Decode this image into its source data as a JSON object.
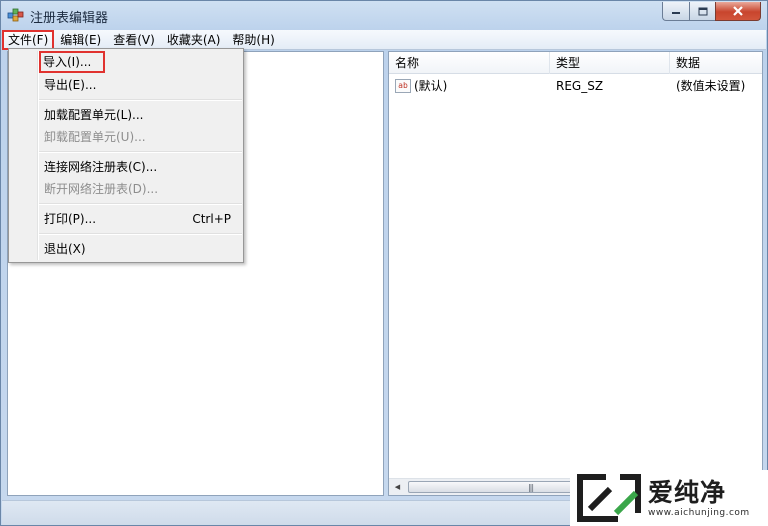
{
  "window": {
    "title": "注册表编辑器",
    "icon": "regedit-icon"
  },
  "menubar": {
    "items": [
      "文件(F)",
      "编辑(E)",
      "查看(V)",
      "收藏夹(A)",
      "帮助(H)"
    ]
  },
  "file_menu": {
    "items": [
      {
        "label": "导入(I)...",
        "disabled": false,
        "highlighted": true
      },
      {
        "label": "导出(E)...",
        "disabled": false
      },
      {
        "label": "加载配置单元(L)...",
        "disabled": false
      },
      {
        "label": "卸载配置单元(U)...",
        "disabled": true
      },
      {
        "label": "连接网络注册表(C)...",
        "disabled": false
      },
      {
        "label": "断开网络注册表(D)...",
        "disabled": true
      },
      {
        "label": "打印(P)...",
        "disabled": false,
        "shortcut": "Ctrl+P"
      },
      {
        "label": "退出(X)",
        "disabled": false
      }
    ]
  },
  "list": {
    "columns": [
      "名称",
      "类型",
      "数据"
    ],
    "rows": [
      {
        "icon": "ab",
        "name": "(默认)",
        "type": "REG_SZ",
        "data": "(数值未设置)"
      }
    ]
  },
  "watermark": {
    "title": "爱纯净",
    "url": "www.aichunjing.com"
  },
  "colors": {
    "highlight_box": "#e0322f"
  }
}
